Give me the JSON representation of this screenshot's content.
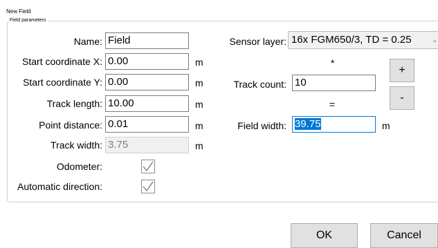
{
  "window": {
    "title": "New Field"
  },
  "group": {
    "label": "Field parameters"
  },
  "fields": {
    "name": {
      "label": "Name:",
      "value": "Field"
    },
    "start_x": {
      "label": "Start coordinate X:",
      "value": "0.00",
      "unit": "m"
    },
    "start_y": {
      "label": "Start coordinate Y:",
      "value": "0.00",
      "unit": "m"
    },
    "track_length": {
      "label": "Track length:",
      "value": "10.00",
      "unit": "m"
    },
    "point_distance": {
      "label": "Point distance:",
      "value": "0.01",
      "unit": "m"
    },
    "track_width": {
      "label": "Track width:",
      "value": "3.75",
      "unit": "m"
    },
    "odometer": {
      "label": "Odometer:",
      "checked": true
    },
    "automatic_direction": {
      "label": "Automatic direction:",
      "checked": true
    }
  },
  "sensor_layer": {
    "label": "Sensor layer:",
    "value": "16x FGM650/3, TD = 0.25"
  },
  "operators": {
    "multiply": "*",
    "equals": "="
  },
  "track_count": {
    "label": "Track count:",
    "value": "10"
  },
  "field_width": {
    "label": "Field width:",
    "value": "39.75",
    "unit": "m"
  },
  "buttons": {
    "plus": "+",
    "minus": "-",
    "ok": "OK",
    "cancel": "Cancel"
  }
}
